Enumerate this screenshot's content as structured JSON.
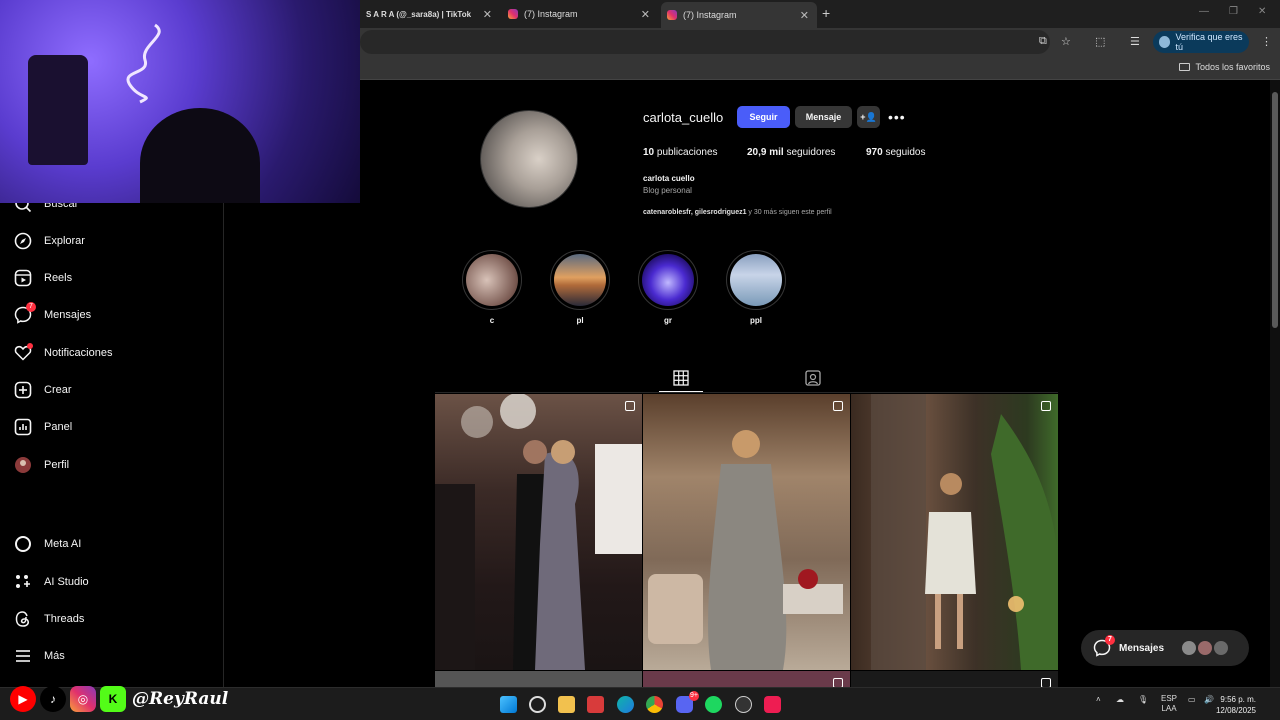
{
  "browser": {
    "tabs": [
      {
        "label": "S A R A (@_sara8a) | TikTok"
      },
      {
        "label": "(7) Instagram"
      },
      {
        "label": "(7) Instagram"
      }
    ],
    "verify_label": "Verifica que eres tú",
    "bookmarks_all": "Todos los favoritos"
  },
  "sidebar": {
    "items": [
      {
        "label": "Buscar",
        "icon": "search-icon"
      },
      {
        "label": "Explorar",
        "icon": "compass-icon"
      },
      {
        "label": "Reels",
        "icon": "reels-icon"
      },
      {
        "label": "Mensajes",
        "icon": "messenger-icon",
        "badge": "7"
      },
      {
        "label": "Notificaciones",
        "icon": "heart-icon"
      },
      {
        "label": "Crear",
        "icon": "plus-square-icon"
      },
      {
        "label": "Panel",
        "icon": "dashboard-icon"
      },
      {
        "label": "Perfil",
        "icon": "avatar-icon"
      },
      {
        "label": "Meta AI",
        "icon": "meta-ai-icon"
      },
      {
        "label": "AI Studio",
        "icon": "ai-studio-icon"
      },
      {
        "label": "Threads",
        "icon": "threads-icon"
      },
      {
        "label": "Más",
        "icon": "menu-icon"
      }
    ]
  },
  "profile": {
    "username": "carlota_cuello",
    "follow_label": "Seguir",
    "message_label": "Mensaje",
    "posts_count": "10",
    "posts_label": "publicaciones",
    "followers_count": "20,9 mil",
    "followers_label": "seguidores",
    "following_count": "970",
    "following_label": "seguidos",
    "full_name": "carlota cuello",
    "category": "Blog personal",
    "followed_by_names": "catenaroblesfr, gilesrodriguez1",
    "followed_by_rest": " y 30 más siguen este perfil"
  },
  "highlights": [
    {
      "label": "c"
    },
    {
      "label": "pl"
    },
    {
      "label": "gr"
    },
    {
      "label": "ppl"
    }
  ],
  "floating_messages": {
    "label": "Mensajes",
    "badge": "7"
  },
  "overlay": {
    "handle": "@ReyRaul"
  },
  "taskbar": {
    "lang_top": "ESP",
    "lang_bottom": "LAA",
    "time": "9:56 p. m.",
    "date": "12/08/2025",
    "notif_badge": "9+"
  },
  "colors": {
    "accent": "#4a5df9",
    "notification": "#ff3040",
    "background": "#000000"
  }
}
